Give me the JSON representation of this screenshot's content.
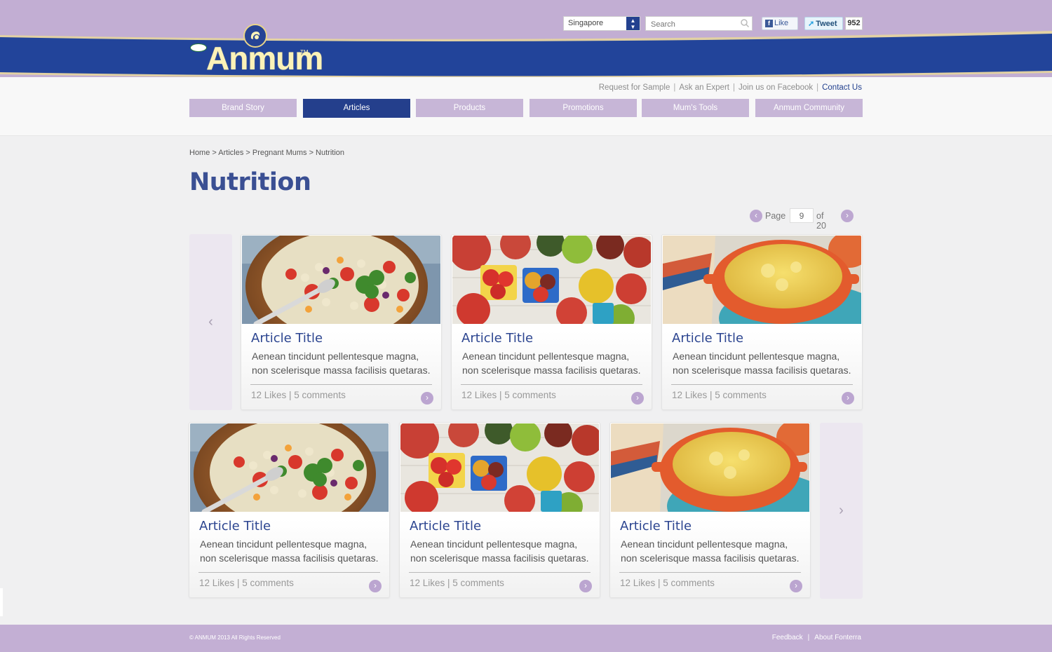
{
  "brand": {
    "name": "Anmum",
    "tm": "TM"
  },
  "header": {
    "country": "Singapore",
    "search_placeholder": "Search",
    "fb_like": "Like",
    "tweet": "Tweet",
    "tweet_count": "952",
    "utility_links": [
      "Request for Sample",
      "Ask an Expert",
      "Join us on Facebook",
      "Contact Us"
    ],
    "active_utility": "Contact Us"
  },
  "nav": {
    "tabs": [
      "Brand Story",
      "Articles",
      "Products",
      "Promotions",
      "Mum's Tools",
      "Anmum Community"
    ],
    "active": "Articles"
  },
  "breadcrumb": "Home > Articles > Pregnant Mums > Nutrition",
  "page_title": "Nutrition",
  "pager": {
    "label": "Page",
    "current": "9",
    "of": "of 20"
  },
  "articles": [
    {
      "title": "Article Title",
      "desc": "Aenean tincidunt pellentesque magna, non scelerisque massa facilisis quetaras.",
      "stats": "12 Likes | 5 comments",
      "image": "salad-bowl"
    },
    {
      "title": "Article Title",
      "desc": "Aenean tincidunt pellentesque magna, non scelerisque massa facilisis quetaras.",
      "stats": "12 Likes | 5 comments",
      "image": "tomatoes"
    },
    {
      "title": "Article Title",
      "desc": "Aenean tincidunt pellentesque magna, non scelerisque massa facilisis quetaras.",
      "stats": "12 Likes | 5 comments",
      "image": "casserole"
    },
    {
      "title": "Article Title",
      "desc": "Aenean tincidunt pellentesque magna, non scelerisque massa facilisis quetaras.",
      "stats": "12 Likes | 5 comments",
      "image": "salad-bowl"
    },
    {
      "title": "Article Title",
      "desc": "Aenean tincidunt pellentesque magna, non scelerisque massa facilisis quetaras.",
      "stats": "12 Likes | 5 comments",
      "image": "tomatoes"
    },
    {
      "title": "Article Title",
      "desc": "Aenean tincidunt pellentesque magna, non scelerisque massa facilisis quetaras.",
      "stats": "12 Likes | 5 comments",
      "image": "casserole"
    }
  ],
  "footer": {
    "copyright": "© ANMUM 2013 All Rights Reserved",
    "links": [
      "Feedback",
      "About Fonterra"
    ]
  },
  "colors": {
    "brand_blue": "#243f8c",
    "lavender": "#c3afd4",
    "gold": "#fbf2b8"
  },
  "icons": {
    "prev": "chevron-left-icon",
    "next": "chevron-right-icon",
    "search": "search-icon",
    "select": "select-arrows-icon"
  }
}
